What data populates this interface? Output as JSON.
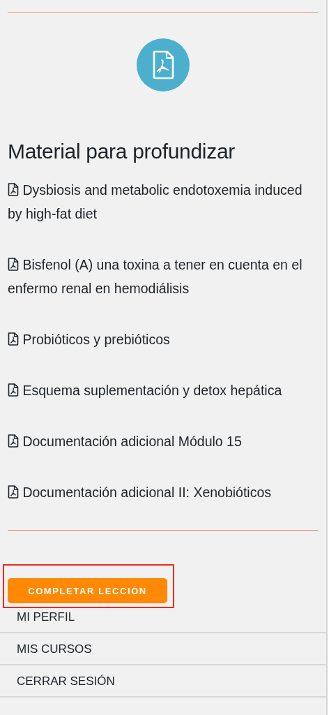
{
  "section": {
    "title": "Material para profundizar",
    "documents": [
      {
        "title": "Dysbiosis and metabolic endotoxemia induced by high-fat diet"
      },
      {
        "title": "Bisfenol (A) una toxina a tener en cuenta en el enfermo renal en hemodiálisis"
      },
      {
        "title": "Probióticos y prebióticos"
      },
      {
        "title": "Esquema suplementación y detox hepática"
      },
      {
        "title": "Documentación adicional Módulo 15"
      },
      {
        "title": "Documentación adicional II: Xenobióticos"
      }
    ]
  },
  "complete_button": {
    "label": "COMPLETAR LECCIÓN"
  },
  "menu": [
    {
      "label": "MI PERFIL"
    },
    {
      "label": "MIS CURSOS"
    },
    {
      "label": "CERRAR SESIÓN"
    }
  ]
}
